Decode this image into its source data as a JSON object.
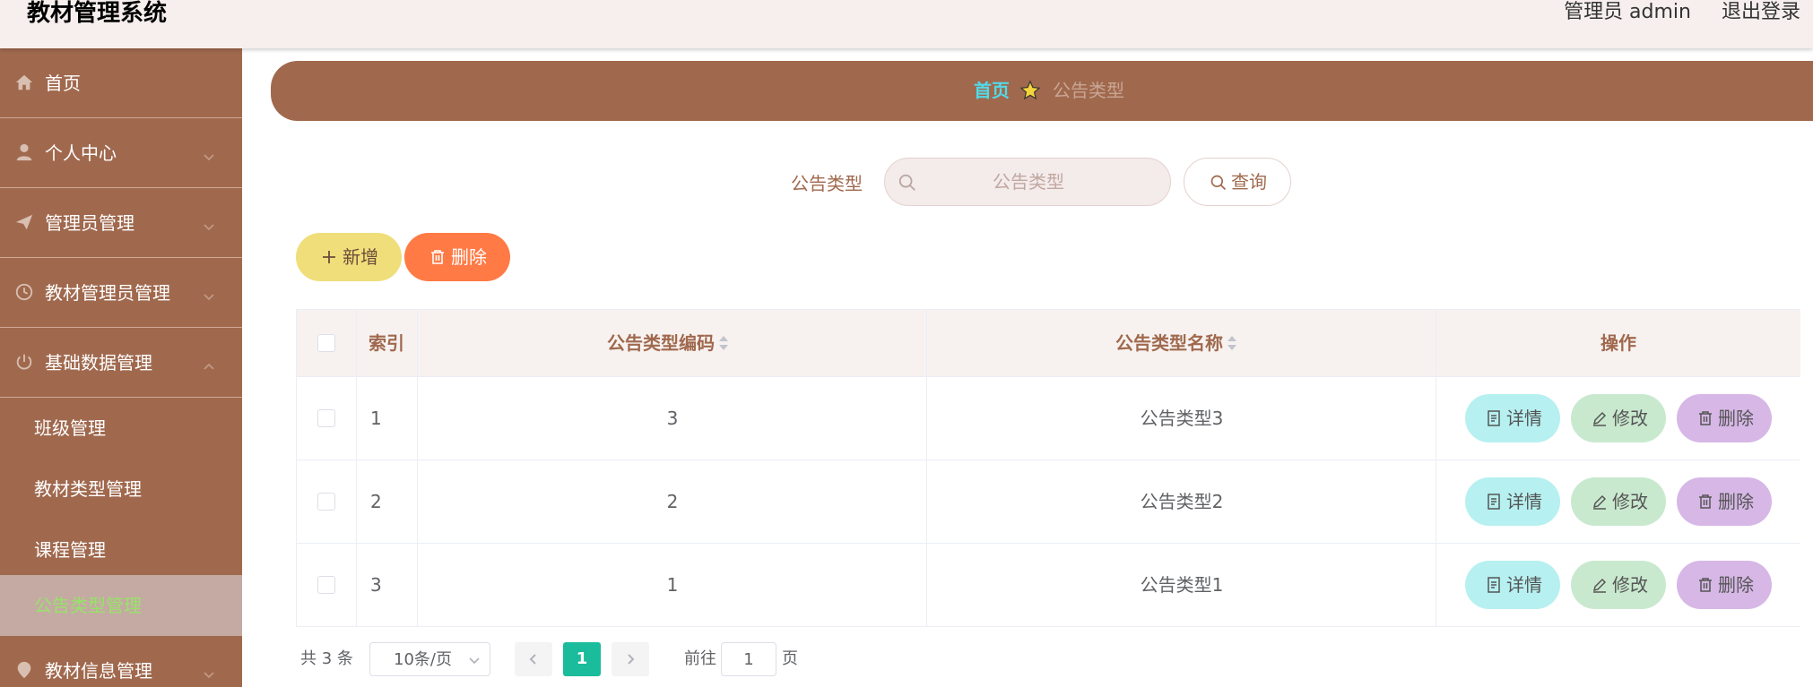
{
  "header": {
    "app_title": "教材管理系统",
    "user": "管理员 admin",
    "logout": "退出登录"
  },
  "sidebar": {
    "items": [
      {
        "label": "首页",
        "icon": "home-icon"
      },
      {
        "label": "个人中心",
        "icon": "user-icon"
      },
      {
        "label": "管理员管理",
        "icon": "paper-plane-icon"
      },
      {
        "label": "教材管理员管理",
        "icon": "clock-icon"
      },
      {
        "label": "基础数据管理",
        "icon": "power-icon"
      }
    ],
    "sub_items": [
      {
        "label": "班级管理"
      },
      {
        "label": "教材类型管理"
      },
      {
        "label": "课程管理"
      },
      {
        "label": "公告类型管理",
        "active": true
      }
    ],
    "bottom_item": {
      "label": "教材信息管理",
      "icon": "location-icon"
    }
  },
  "breadcrumb": {
    "home": "首页",
    "current": "公告类型"
  },
  "search": {
    "label": "公告类型",
    "placeholder": "公告类型",
    "button": "查询"
  },
  "actions": {
    "add": "新增",
    "delete": "删除"
  },
  "table": {
    "headers": [
      "索引",
      "公告类型编码",
      "公告类型名称",
      "操作"
    ],
    "rows": [
      {
        "index": "1",
        "code": "3",
        "name": "公告类型3"
      },
      {
        "index": "2",
        "code": "2",
        "name": "公告类型2"
      },
      {
        "index": "3",
        "code": "1",
        "name": "公告类型1"
      }
    ],
    "row_actions": {
      "detail": "详情",
      "edit": "修改",
      "delete": "删除"
    }
  },
  "pagination": {
    "total": "共 3 条",
    "page_size": "10条/页",
    "current_page": "1",
    "goto_label": "前往",
    "goto_value": "1",
    "page_suffix": "页"
  },
  "colors": {
    "brand": "#a0694e",
    "breadcrumb_home": "#52d9e8",
    "active_submenu_text": "#97e36a",
    "add_button": "#f0de7a",
    "delete_button": "#ff7a45",
    "pagination_active": "#1abc9c"
  }
}
